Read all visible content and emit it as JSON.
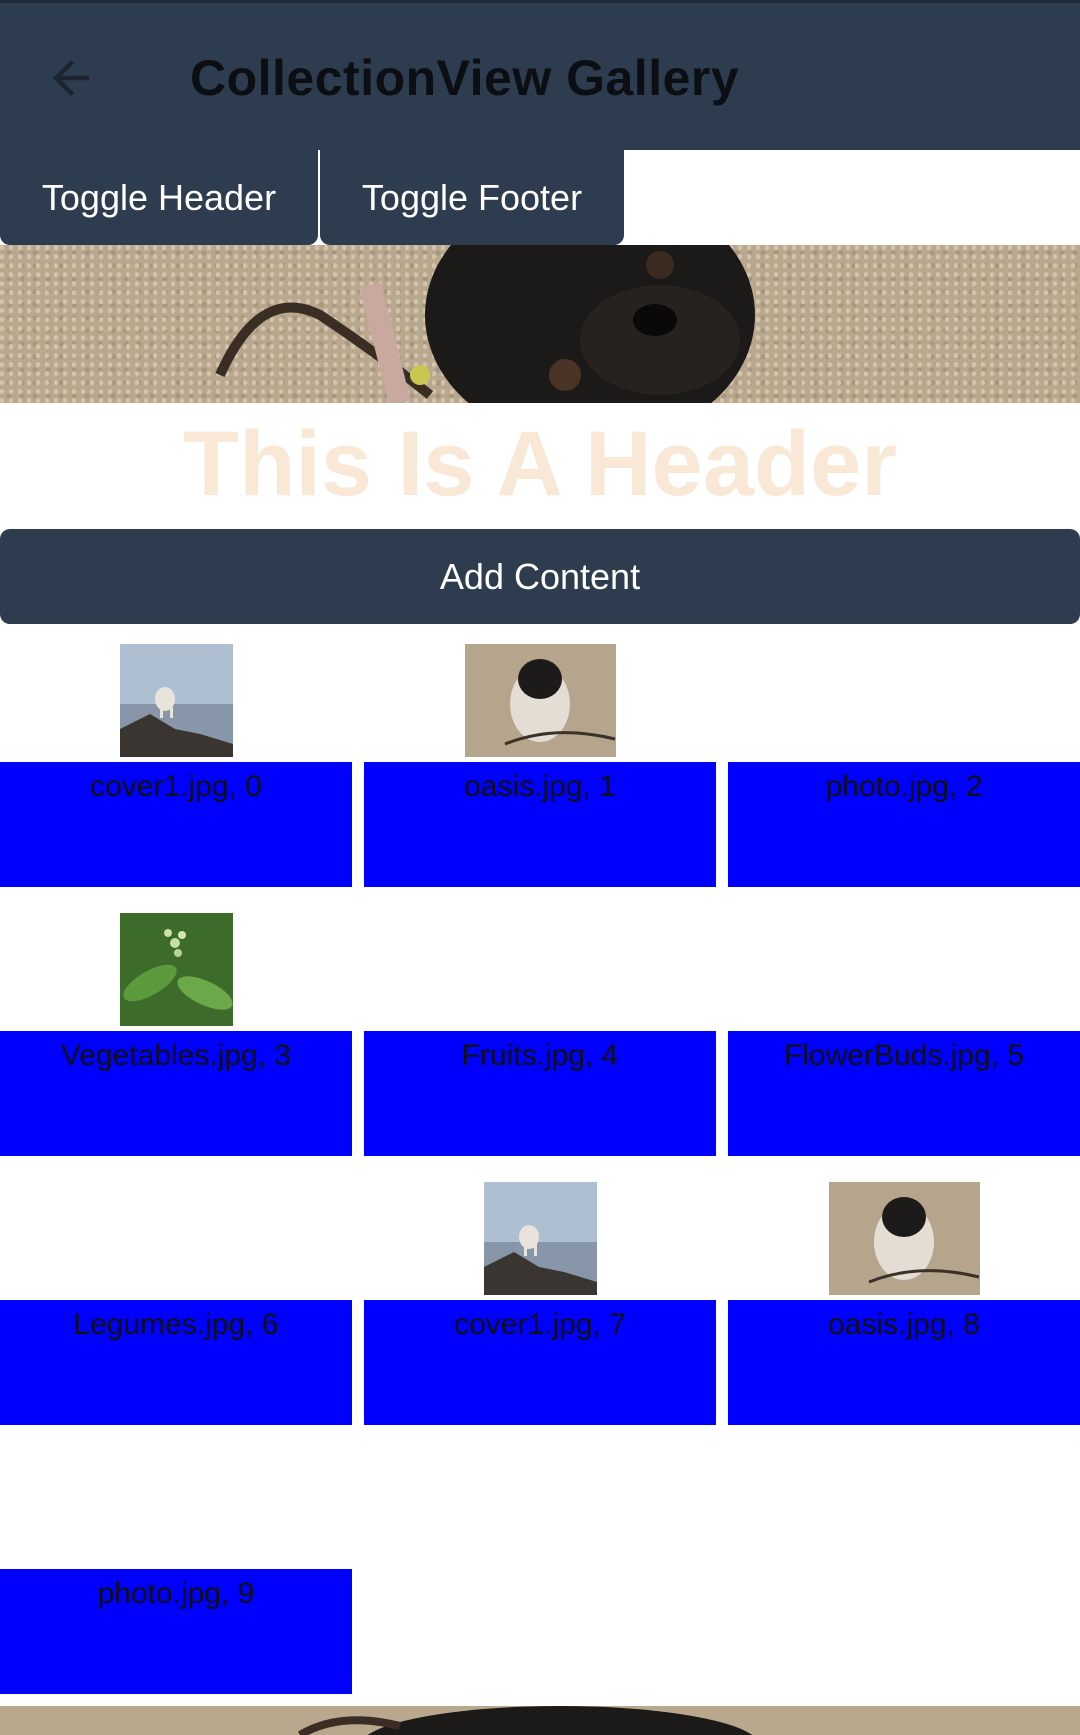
{
  "appbar": {
    "title": "CollectionView Gallery",
    "back_icon": "arrow-left-icon"
  },
  "toolbar": {
    "toggle_header_label": "Toggle Header",
    "toggle_footer_label": "Toggle Footer"
  },
  "header": {
    "text": "This Is A Header",
    "text_color": "#f9e8d6"
  },
  "add_content_label": "Add Content",
  "items": [
    {
      "label": "cover1.jpg, 0",
      "image": "mountain-goat"
    },
    {
      "label": "oasis.jpg, 1",
      "image": "pug"
    },
    {
      "label": "photo.jpg, 2",
      "image": ""
    },
    {
      "label": "Vegetables.jpg, 3",
      "image": "plant"
    },
    {
      "label": "Fruits.jpg, 4",
      "image": ""
    },
    {
      "label": "FlowerBuds.jpg, 5",
      "image": ""
    },
    {
      "label": "Legumes.jpg, 6",
      "image": ""
    },
    {
      "label": "cover1.jpg, 7",
      "image": "mountain-goat"
    },
    {
      "label": "oasis.jpg, 8",
      "image": "pug"
    },
    {
      "label": "photo.jpg, 9",
      "image": ""
    }
  ],
  "colors": {
    "appbar": "#2d3c4f",
    "item_background": "#0000ff"
  }
}
